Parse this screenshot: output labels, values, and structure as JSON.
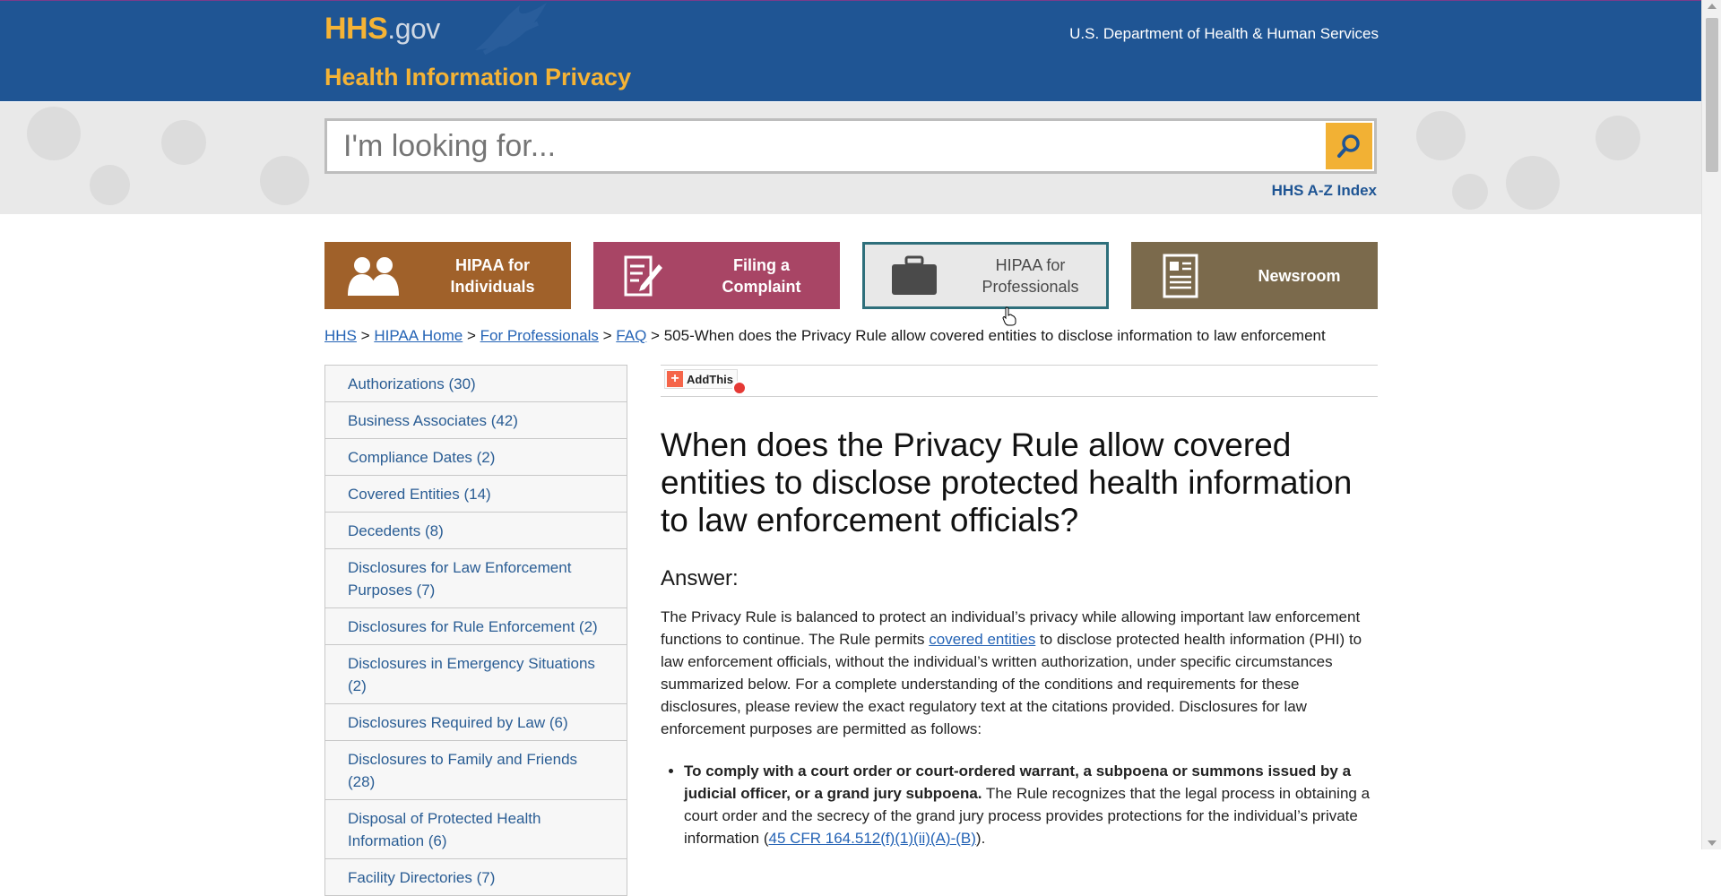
{
  "header": {
    "logo_main": "HHS",
    "logo_suffix": ".gov",
    "agency": "U.S. Department of Health & Human Services",
    "site_title": "Health Information Privacy"
  },
  "search": {
    "placeholder": "I'm looking for...",
    "az_index": "HHS A-Z Index"
  },
  "tiles": [
    {
      "label": "HIPAA for Individuals",
      "icon": "people-icon",
      "color": "#a0612a"
    },
    {
      "label": "Filing a Complaint",
      "icon": "document-pen-icon",
      "color": "#a84565"
    },
    {
      "label": "HIPAA for Professionals",
      "icon": "briefcase-icon",
      "color": "#e8e8e8"
    },
    {
      "label": "Newsroom",
      "icon": "newspaper-icon",
      "color": "#7b6a4c"
    }
  ],
  "breadcrumb": {
    "items": [
      "HHS",
      "HIPAA Home",
      "For Professionals",
      "FAQ"
    ],
    "separator": ">",
    "current": "505-When does the Privacy Rule allow covered entities to disclose information to law enforcement"
  },
  "sidebar": {
    "items": [
      "Authorizations (30)",
      "Business Associates (42)",
      "Compliance Dates (2)",
      "Covered Entities (14)",
      "Decedents (8)",
      "Disclosures for Law Enforcement Purposes (7)",
      "Disclosures for Rule Enforcement (2)",
      "Disclosures in Emergency Situations (2)",
      "Disclosures Required by Law (6)",
      "Disclosures to Family and Friends (28)",
      "Disposal of Protected Health Information (6)",
      "Facility Directories (7)"
    ]
  },
  "share": {
    "label": "AddThis"
  },
  "article": {
    "question": "When does the Privacy Rule allow covered entities to disclose protected health information to law enforcement officials?",
    "answer_heading": "Answer:",
    "para1_a": "The Privacy Rule is balanced to protect an individual’s privacy while allowing important law enforcement functions to continue. The Rule permits ",
    "para1_link": "covered entities",
    "para1_b": " to disclose protected health information (PHI) to law enforcement officials, without the individual’s written authorization, under specific circumstances summarized below. For a complete understanding of the conditions and requirements for these disclosures, please review the exact regulatory text at the citations provided. Disclosures for law enforcement purposes are permitted as follows:",
    "bullet1_bold": "To comply with a court order or court-ordered warrant, a subpoena or summons issued by a judicial officer, or a grand jury subpoena.",
    "bullet1_text": " The Rule recognizes that the legal process in obtaining a court order and the secrecy of the grand jury process provides protections for the individual’s private information (",
    "bullet1_link": "45 CFR 164.512(f)(1)(ii)(A)-(B)",
    "bullet1_end": ")."
  }
}
